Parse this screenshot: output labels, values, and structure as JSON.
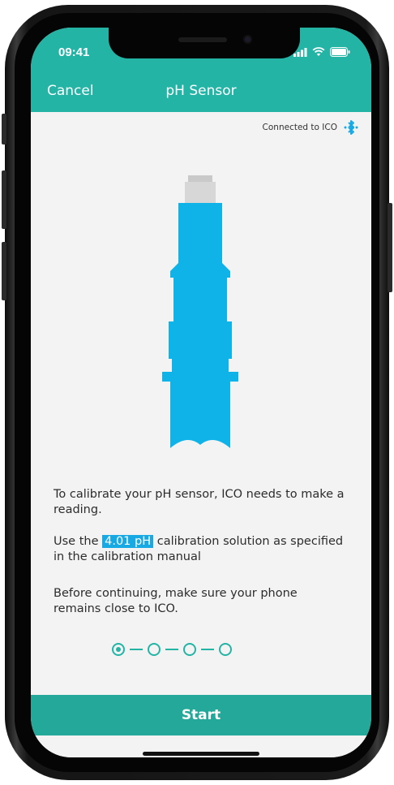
{
  "status_bar": {
    "time": "09:41"
  },
  "nav": {
    "cancel_label": "Cancel",
    "title": "pH Sensor"
  },
  "connection": {
    "text": "Connected to ICO",
    "icon": "bluetooth-icon"
  },
  "instructions": {
    "line1": "To calibrate your pH sensor, ICO needs to make a reading.",
    "line2_prefix": "Use the ",
    "line2_highlight": "4.01 pH",
    "line2_suffix": " calibration solution as specified in the calibration manual",
    "line3": "Before continuing, make sure your phone remains close to ICO."
  },
  "stepper": {
    "total_steps": 4,
    "current_step": 1
  },
  "actions": {
    "start_label": "Start"
  },
  "colors": {
    "brand": "#24b4a6",
    "accent": "#16a9e3",
    "button": "#24a899"
  }
}
